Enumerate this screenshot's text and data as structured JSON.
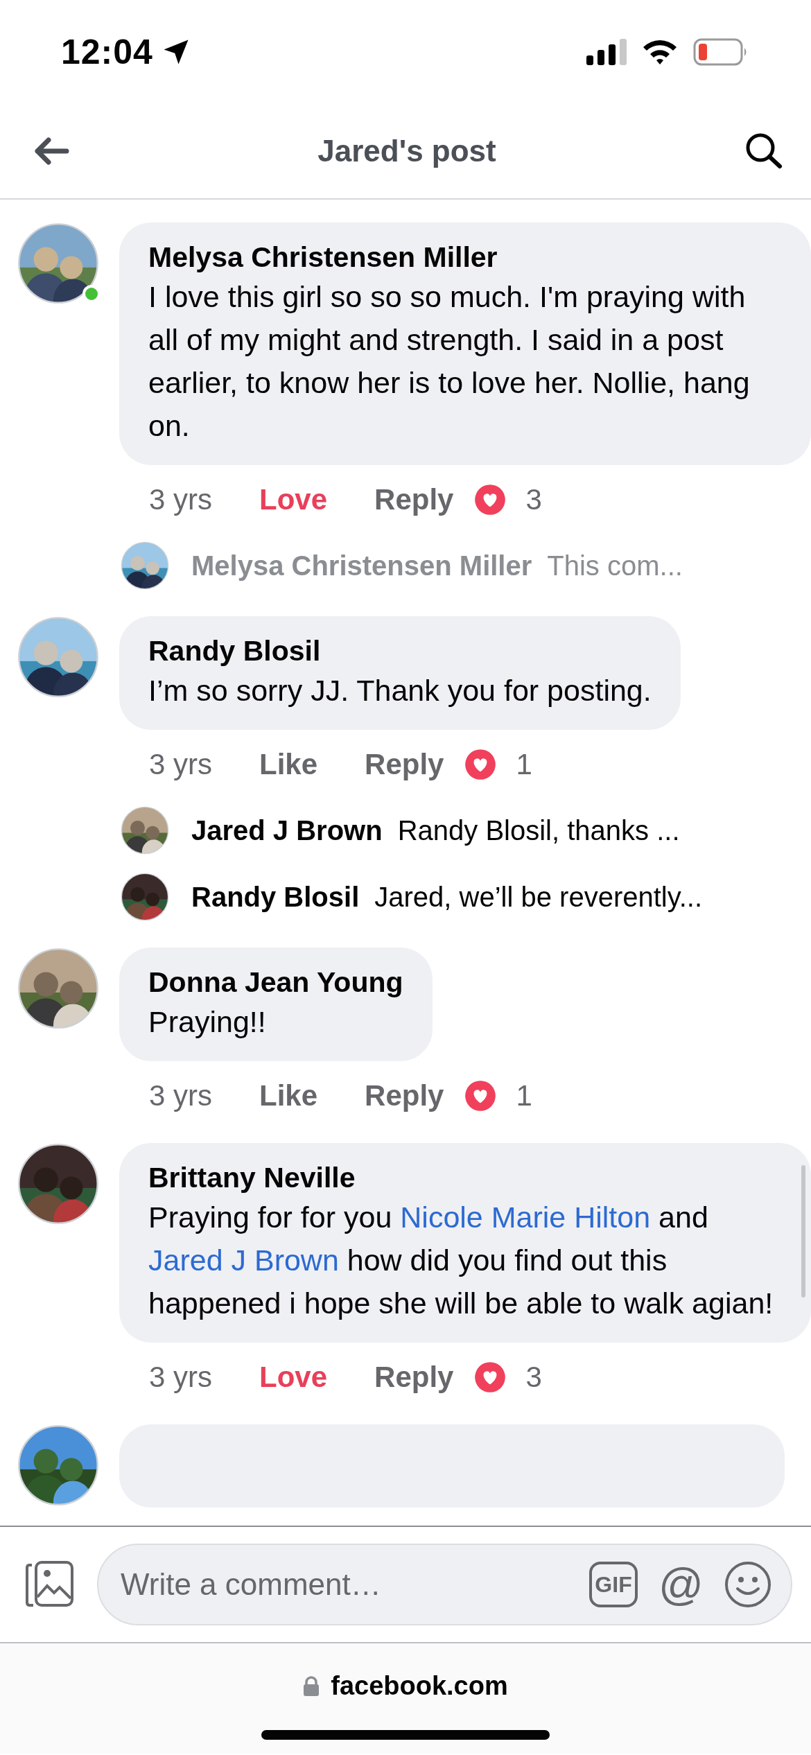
{
  "status_bar": {
    "time": "12:04"
  },
  "header": {
    "title": "Jared's post"
  },
  "comments": [
    {
      "author": "Melysa Christensen Miller",
      "online": true,
      "body": [
        {
          "kind": "plain",
          "text": "I love this girl so so so much. I'm praying with all of my might and strength. I said in a post earlier, to know her is to love her. Nollie, hang on."
        }
      ],
      "time": "3 yrs",
      "reaction_label": "Love",
      "reacted": true,
      "reply_label": "Reply",
      "reaction_count": "3",
      "replies": [
        {
          "author": "Melysa Christensen Miller",
          "text": "This com...",
          "dimmed": true
        }
      ]
    },
    {
      "author": "Randy Blosil",
      "online": false,
      "body": [
        {
          "kind": "plain",
          "text": "I’m so sorry JJ. Thank you for posting."
        }
      ],
      "time": "3 yrs",
      "reaction_label": "Like",
      "reacted": false,
      "reply_label": "Reply",
      "reaction_count": "1",
      "replies": [
        {
          "author": "Jared J Brown",
          "text": "Randy Blosil, thanks ...",
          "dimmed": false
        },
        {
          "author": "Randy Blosil",
          "text": "Jared, we’ll be reverently...",
          "dimmed": false
        }
      ]
    },
    {
      "author": "Donna Jean Young",
      "online": false,
      "body": [
        {
          "kind": "plain",
          "text": "Praying!!"
        }
      ],
      "time": "3 yrs",
      "reaction_label": "Like",
      "reacted": false,
      "reply_label": "Reply",
      "reaction_count": "1"
    },
    {
      "author": "Brittany Neville",
      "online": false,
      "body": [
        {
          "kind": "plain",
          "text": "Praying for for you "
        },
        {
          "kind": "mention",
          "text": "Nicole Marie Hilton"
        },
        {
          "kind": "plain",
          "text": " and "
        },
        {
          "kind": "mention",
          "text": "Jared J Brown"
        },
        {
          "kind": "plain",
          "text": " how did you find out this happened i hope she will be able to walk agian!"
        }
      ],
      "time": "3 yrs",
      "reaction_label": "Love",
      "reacted": true,
      "reply_label": "Reply",
      "reaction_count": "3"
    }
  ],
  "composer": {
    "placeholder": "Write a comment…",
    "gif_label": "GIF",
    "mention_label": "@"
  },
  "url_bar": {
    "domain": "facebook.com"
  }
}
